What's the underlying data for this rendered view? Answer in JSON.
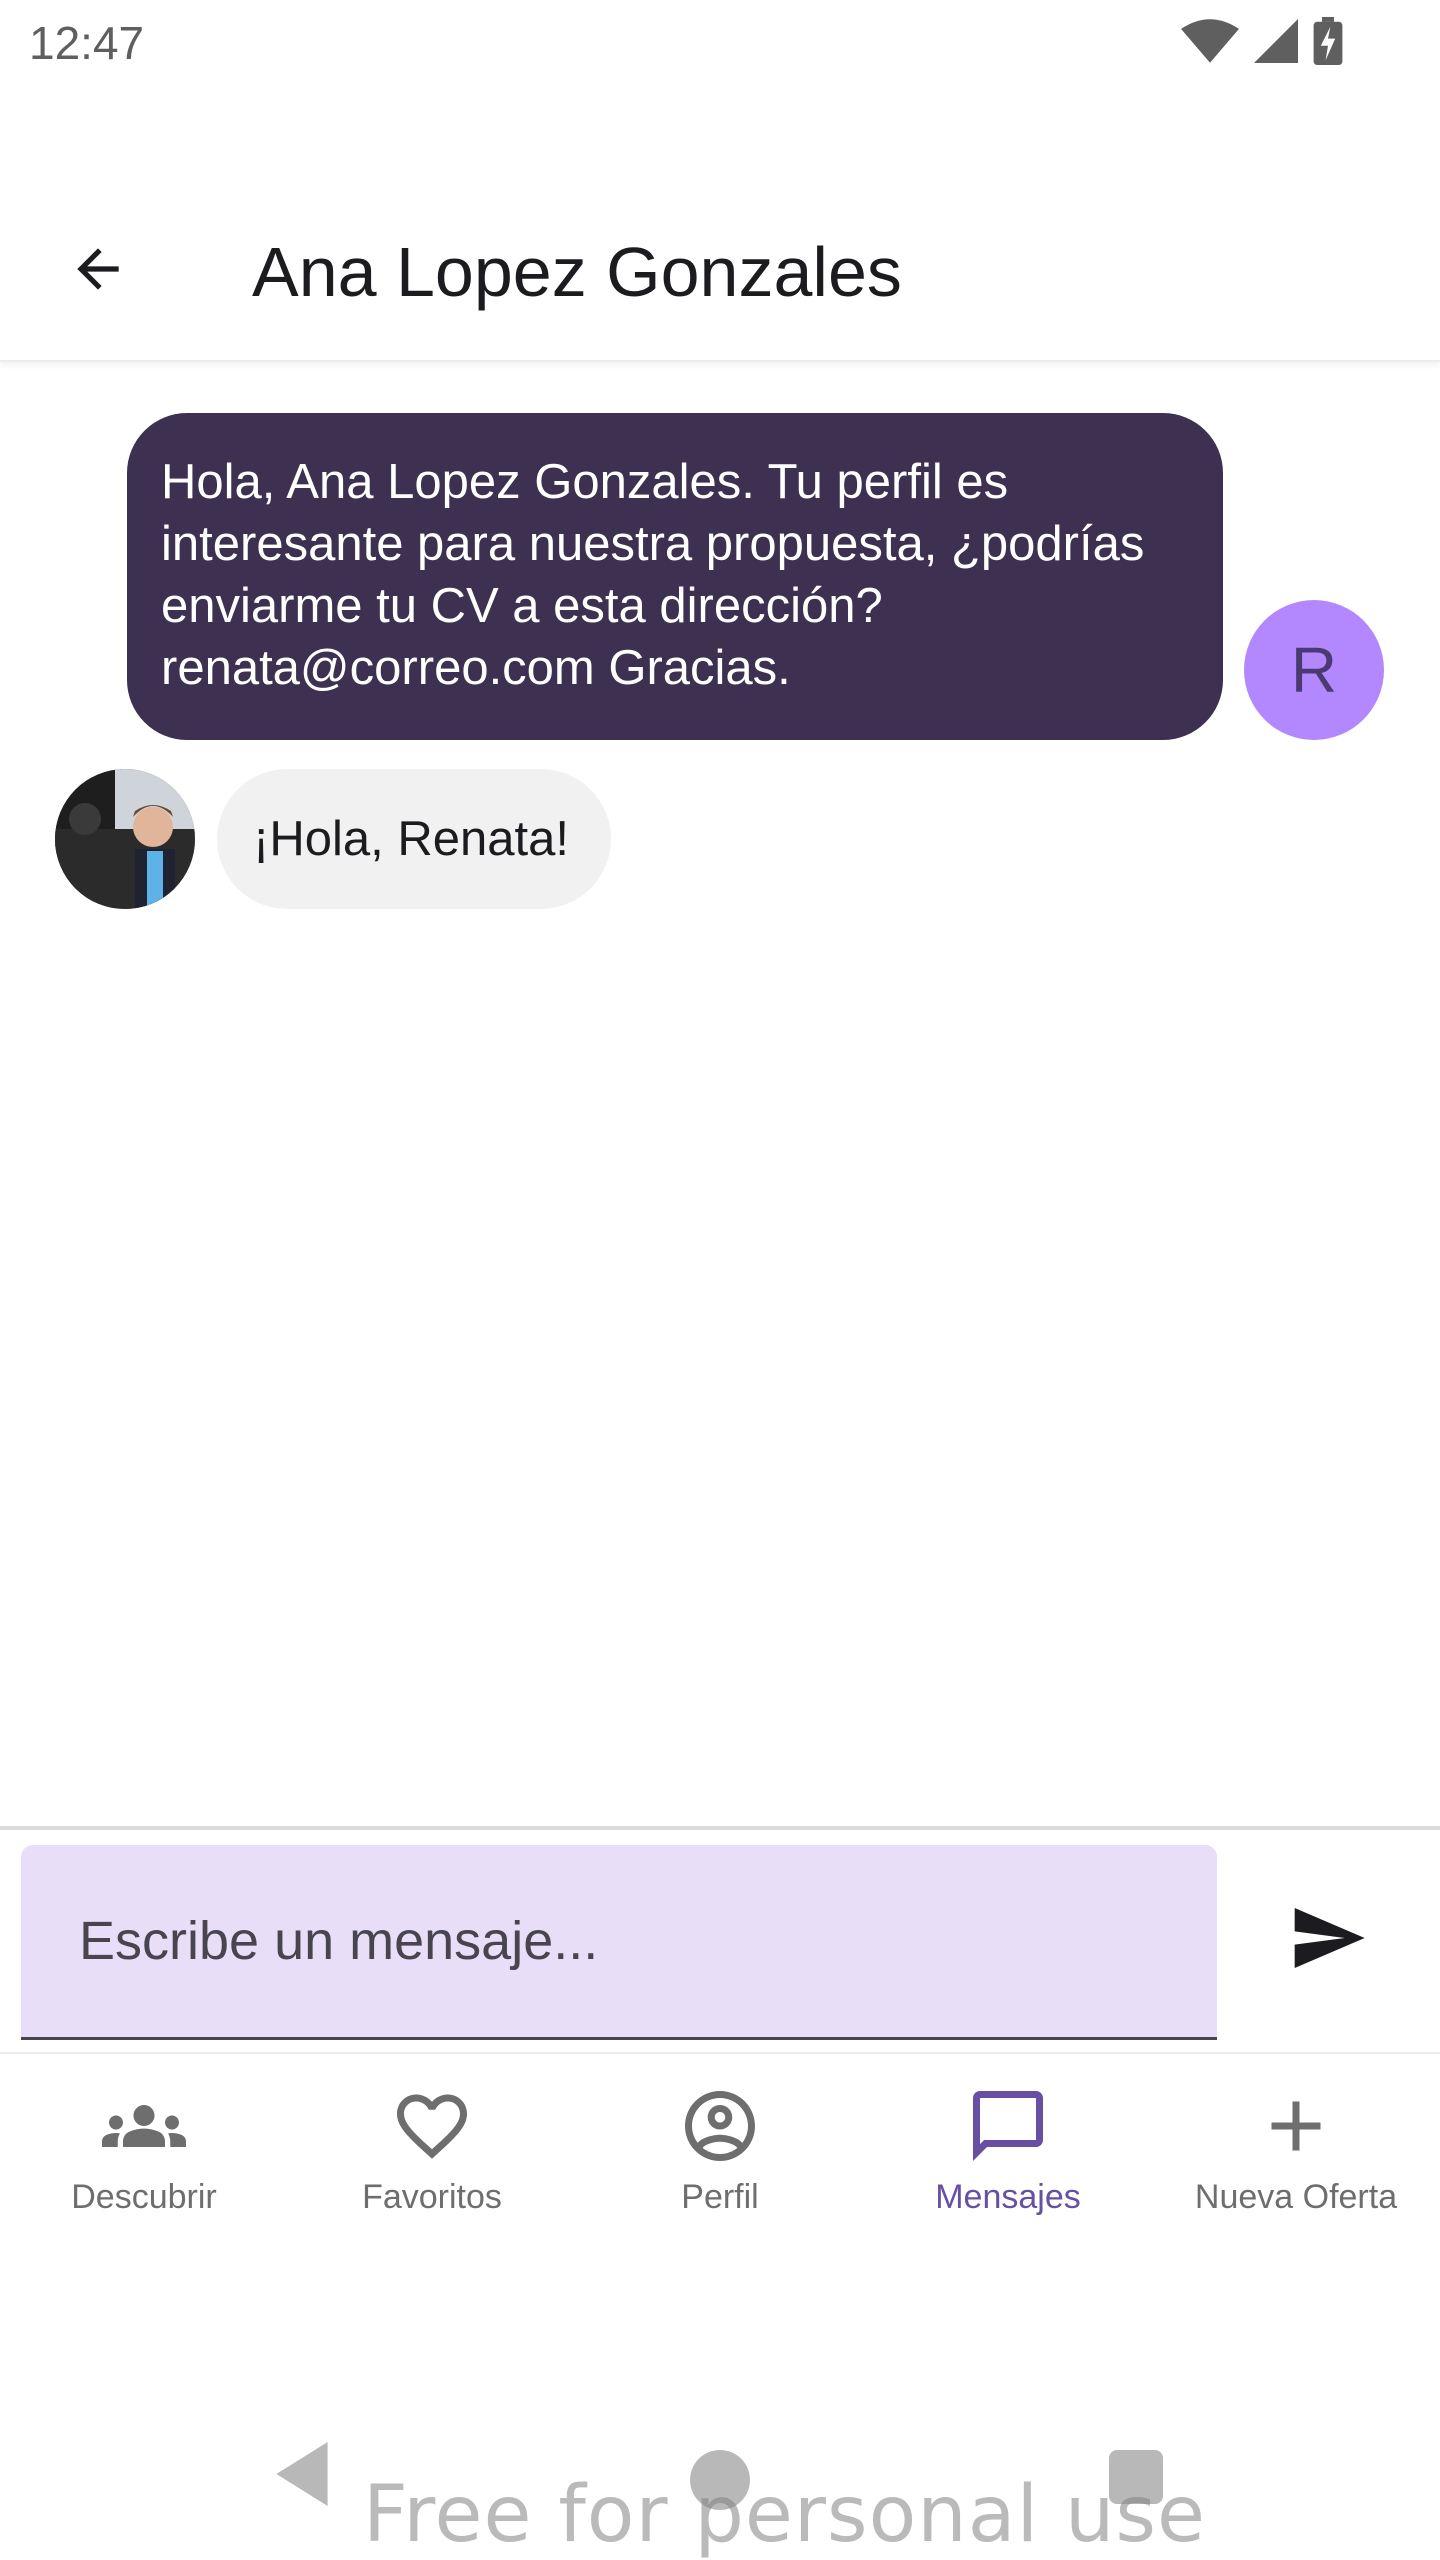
{
  "status_bar": {
    "time": "12:47",
    "icons": [
      "wifi-icon",
      "signal-icon",
      "battery-charging-icon"
    ]
  },
  "app_bar": {
    "back_icon": "arrow-back-icon",
    "title": "Ana Lopez Gonzales"
  },
  "messages": [
    {
      "direction": "outgoing",
      "text": "Hola, Ana Lopez Gonzales. Tu perfil es interesante para nuestra propuesta, ¿podrías enviarme tu CV a esta dirección? renata@correo.com Gracias.",
      "avatar_letter": "R"
    },
    {
      "direction": "incoming",
      "text": "¡Hola, Renata!",
      "avatar": "contact-photo"
    }
  ],
  "composer": {
    "placeholder": "Escribe un mensaje...",
    "send_icon": "send-icon"
  },
  "bottom_nav": {
    "items": [
      {
        "label": "Descubrir",
        "icon": "group-icon",
        "active": false
      },
      {
        "label": "Favoritos",
        "icon": "heart-icon",
        "active": false
      },
      {
        "label": "Perfil",
        "icon": "account-circle-icon",
        "active": false
      },
      {
        "label": "Mensajes",
        "icon": "chat-bubble-icon",
        "active": true
      },
      {
        "label": "Nueva Oferta",
        "icon": "plus-icon",
        "active": false
      }
    ]
  },
  "system_nav": {
    "icons": [
      "back-triangle-icon",
      "home-circle-icon",
      "recents-square-icon"
    ]
  },
  "watermark": "Free for personal use",
  "colors": {
    "outgoing_bubble": "#3d3050",
    "incoming_bubble": "#f1f1f1",
    "avatar_r": "#b388ff",
    "composer_bg": "#e8def8",
    "accent": "#6750a4"
  }
}
